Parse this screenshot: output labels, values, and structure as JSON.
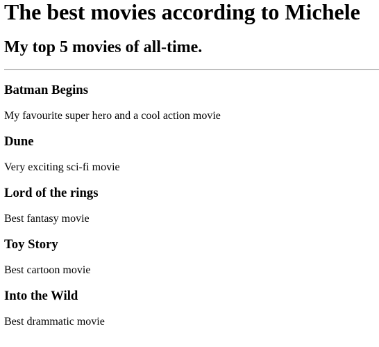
{
  "header": {
    "title": "The best movies according to Michele",
    "subtitle": "My top 5 movies of all-time."
  },
  "movies": [
    {
      "title": "Batman Begins",
      "description": "My favourite super hero and a cool action movie"
    },
    {
      "title": "Dune",
      "description": "Very exciting sci-fi movie"
    },
    {
      "title": "Lord of the rings",
      "description": "Best fantasy movie"
    },
    {
      "title": "Toy Story",
      "description": "Best cartoon movie"
    },
    {
      "title": "Into the Wild",
      "description": "Best drammatic movie"
    }
  ]
}
